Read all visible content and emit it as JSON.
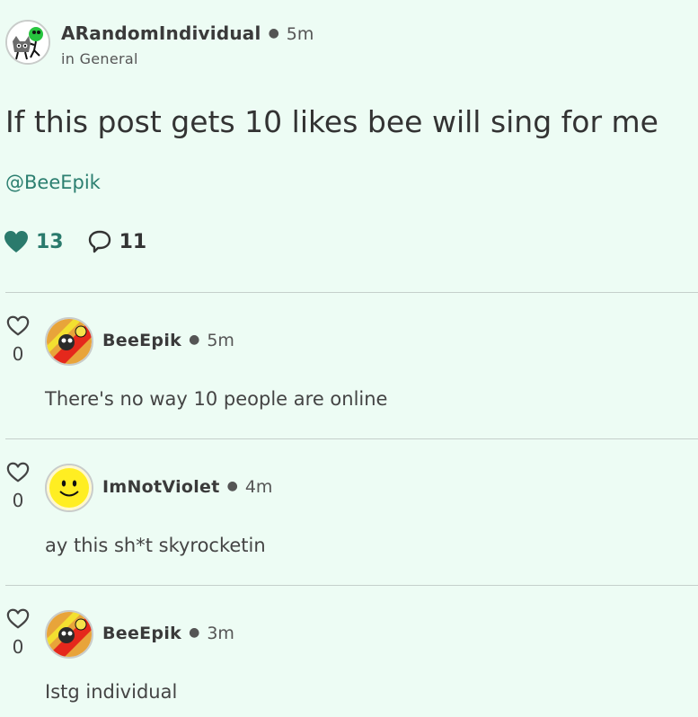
{
  "post": {
    "author": "ARandomIndividual",
    "time": "5m",
    "location": "in General",
    "title": "If this post gets 10 likes bee will sing for me",
    "mention": "@BeeEpik",
    "likes": "13",
    "comments": "11"
  },
  "icons": {
    "post_like": "heart-filled-icon",
    "post_comment": "speech-bubble-icon",
    "comment_like": "heart-outline-icon"
  },
  "colors": {
    "background": "#edfcf4",
    "accent": "#2a7a6c",
    "mention": "#2c7f70"
  },
  "comments_list": [
    {
      "author": "BeeEpik",
      "time": "5m",
      "likes": "0",
      "text": "There's no way 10 people are online"
    },
    {
      "author": "ImNotViolet",
      "time": "4m",
      "likes": "0",
      "text": "ay this sh*t skyrocketin"
    },
    {
      "author": "BeeEpik",
      "time": "3m",
      "likes": "0",
      "text": "Istg individual"
    }
  ]
}
